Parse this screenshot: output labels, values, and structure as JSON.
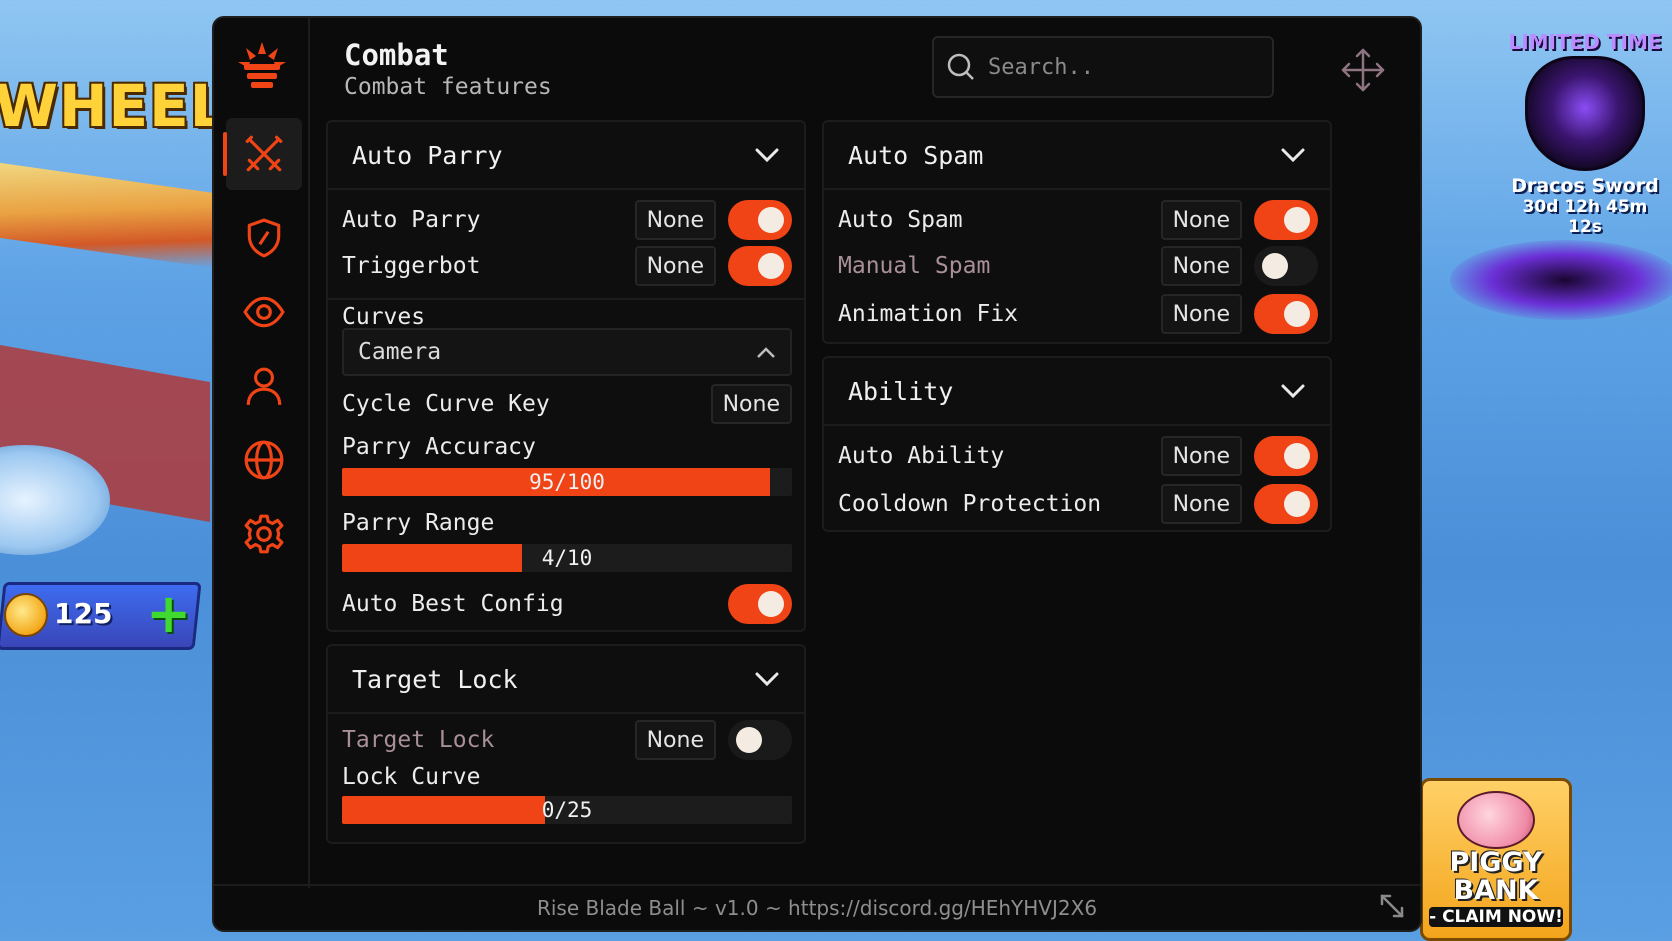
{
  "game": {
    "mode_banner": "WHEELS",
    "coins": "125",
    "add_coins_label": "+",
    "promo": {
      "badge": "LIMITED TIME",
      "item_name": "Dracos Sword",
      "timer": "30d 12h 45m 12s"
    },
    "piggy": {
      "line1": "PIGGY",
      "line2": "BANK",
      "cta": "- CLAIM NOW!"
    }
  },
  "header": {
    "title": "Combat",
    "subtitle": "Combat features"
  },
  "search": {
    "placeholder": "Search.."
  },
  "sidebar": {
    "items": [
      {
        "icon": "swords-icon",
        "active": true
      },
      {
        "icon": "shield-icon",
        "active": false
      },
      {
        "icon": "eye-icon",
        "active": false
      },
      {
        "icon": "user-icon",
        "active": false
      },
      {
        "icon": "globe-icon",
        "active": false
      },
      {
        "icon": "gear-icon",
        "active": false
      }
    ]
  },
  "auto_parry": {
    "title": "Auto Parry",
    "rows": [
      {
        "label": "Auto Parry",
        "key": "None",
        "on": true
      },
      {
        "label": "Triggerbot",
        "key": "None",
        "on": true
      }
    ],
    "curves": {
      "label": "Curves",
      "selected": "Camera"
    },
    "cycle_curve_key": {
      "label": "Cycle Curve Key",
      "key": "None"
    },
    "parry_accuracy": {
      "label": "Parry Accuracy",
      "value": 95,
      "max": 100,
      "display": "95/100"
    },
    "parry_range": {
      "label": "Parry Range",
      "value": 4,
      "max": 10,
      "display": "4/10"
    },
    "auto_best_config": {
      "label": "Auto Best Config",
      "on": true
    }
  },
  "target_lock": {
    "title": "Target Lock",
    "row": {
      "label": "Target Lock",
      "key": "None",
      "on": false
    },
    "lock_curve": {
      "label": "Lock Curve",
      "value": 0,
      "max": 25,
      "display": "0/25"
    }
  },
  "auto_spam": {
    "title": "Auto Spam",
    "rows": [
      {
        "label": "Auto Spam",
        "key": "None",
        "on": true
      },
      {
        "label": "Manual Spam",
        "key": "None",
        "on": false
      },
      {
        "label": "Animation Fix",
        "key": "None",
        "on": true
      }
    ]
  },
  "ability": {
    "title": "Ability",
    "rows": [
      {
        "label": "Auto Ability",
        "key": "None",
        "on": true
      },
      {
        "label": "Cooldown Protection",
        "key": "None",
        "on": true
      }
    ]
  },
  "footer": {
    "text": "Rise Blade Ball ~ v1.0 ~ https://discord.gg/HEhYHVJ2X6"
  },
  "colors": {
    "accent": "#f04416",
    "panel": "#0e0e0e",
    "window": "#0b0b0b"
  }
}
